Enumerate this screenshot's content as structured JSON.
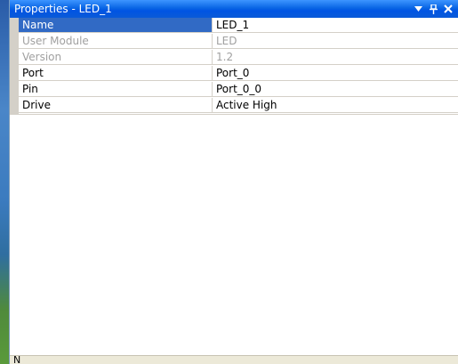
{
  "window": {
    "title": "Properties - LED_1",
    "buttons": {
      "dropdown": "dropdown-icon",
      "pin": "pin-icon",
      "close": "close-icon"
    }
  },
  "properties": [
    {
      "name": "Name",
      "value": "LED_1",
      "state": "selected"
    },
    {
      "name": "User Module",
      "value": "LED",
      "state": "disabled"
    },
    {
      "name": "Version",
      "value": "1.2",
      "state": "disabled"
    },
    {
      "name": "Port",
      "value": "Port_0",
      "state": "normal"
    },
    {
      "name": "Pin",
      "value": "Port_0_0",
      "state": "normal"
    },
    {
      "name": "Drive",
      "value": "Active High",
      "state": "normal"
    }
  ],
  "status": {
    "text": "N"
  },
  "colors": {
    "title_bar": "#0054e3",
    "selection": "#316ac5",
    "disabled_text": "#a0a0a0",
    "gutter": "#d4d0c8"
  }
}
